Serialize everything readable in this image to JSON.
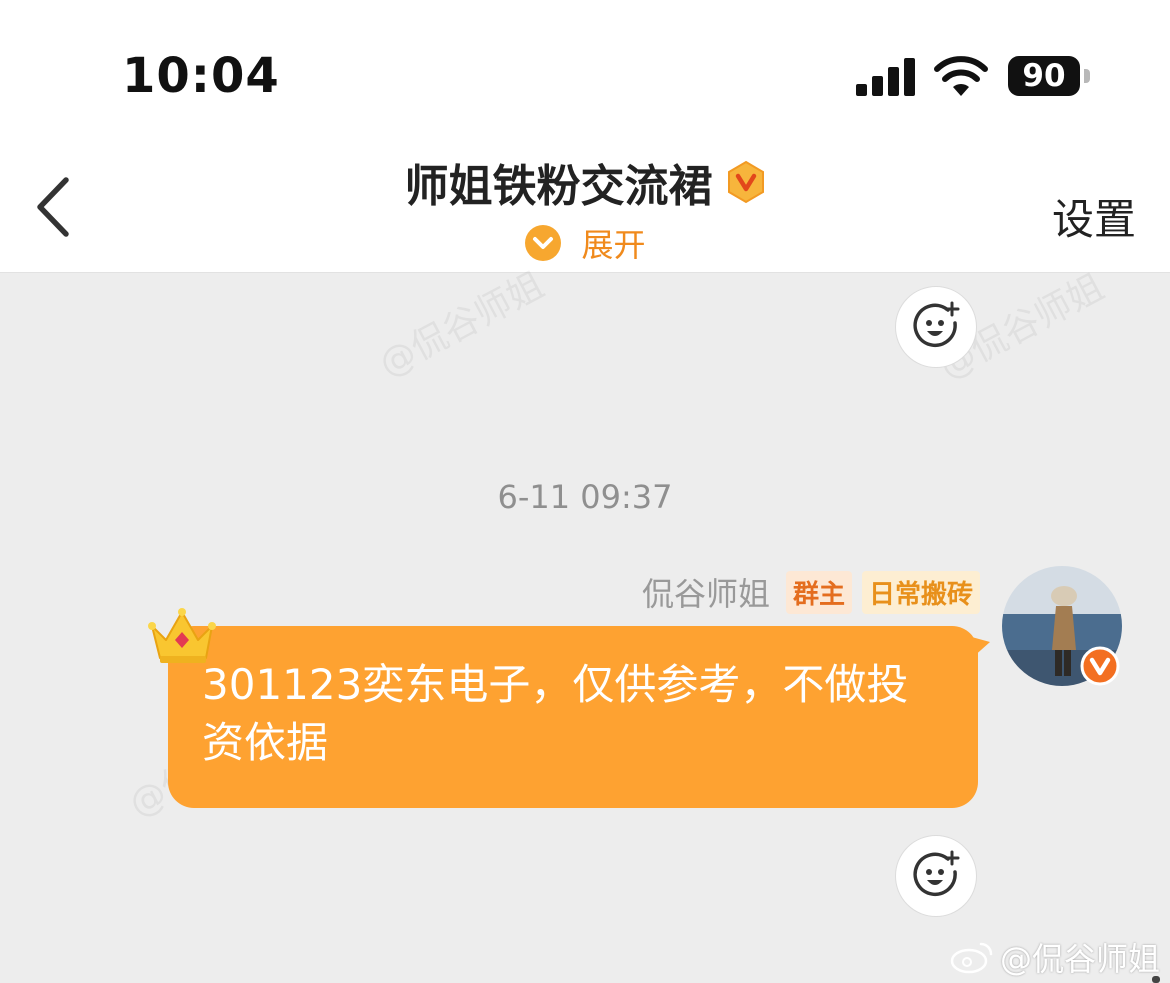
{
  "status_bar": {
    "time": "10:04",
    "battery": "90"
  },
  "header": {
    "title": "师姐铁粉交流裙",
    "expand_label": "展开",
    "settings_label": "设置"
  },
  "chat": {
    "timestamp": "6-11 09:37",
    "message": {
      "sender": "侃谷师姐",
      "tags": [
        "群主",
        "日常搬砖"
      ],
      "text": "301123奕东电子，仅供参考，不做投资依据"
    }
  },
  "watermark": {
    "text": "@侃谷师姐"
  },
  "colors": {
    "bubble": "#fea231",
    "accent": "#f08a1c",
    "background": "#ededed"
  }
}
